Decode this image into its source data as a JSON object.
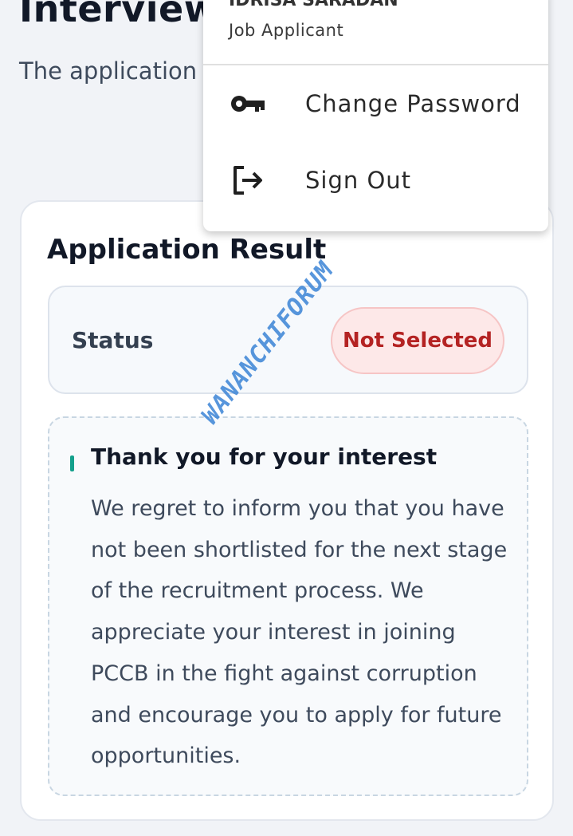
{
  "page": {
    "title": "Interview",
    "intro": "The application can view your d below."
  },
  "result": {
    "title": "Application Result",
    "status_label": "Status",
    "status_value": "Not Selected",
    "message_title": "Thank you for your interest",
    "message_body": "We regret to inform you that you have not been shortlisted for the next stage of the recruitment process. We appreciate your interest in joining PCCB in the fight against corruption and encourage you to apply for future opportunities."
  },
  "watermark": "WANANCHIFORUM",
  "user_menu": {
    "user_name": "IDRISA SARADAN",
    "role": "Job Applicant",
    "items": [
      {
        "label": "Change Password",
        "icon": "key-icon"
      },
      {
        "label": "Sign Out",
        "icon": "logout-icon"
      }
    ]
  },
  "colors": {
    "badge_text": "#b42323",
    "badge_bg": "#fde8e8",
    "accent": "#14a08c",
    "watermark": "#3b84d6"
  }
}
